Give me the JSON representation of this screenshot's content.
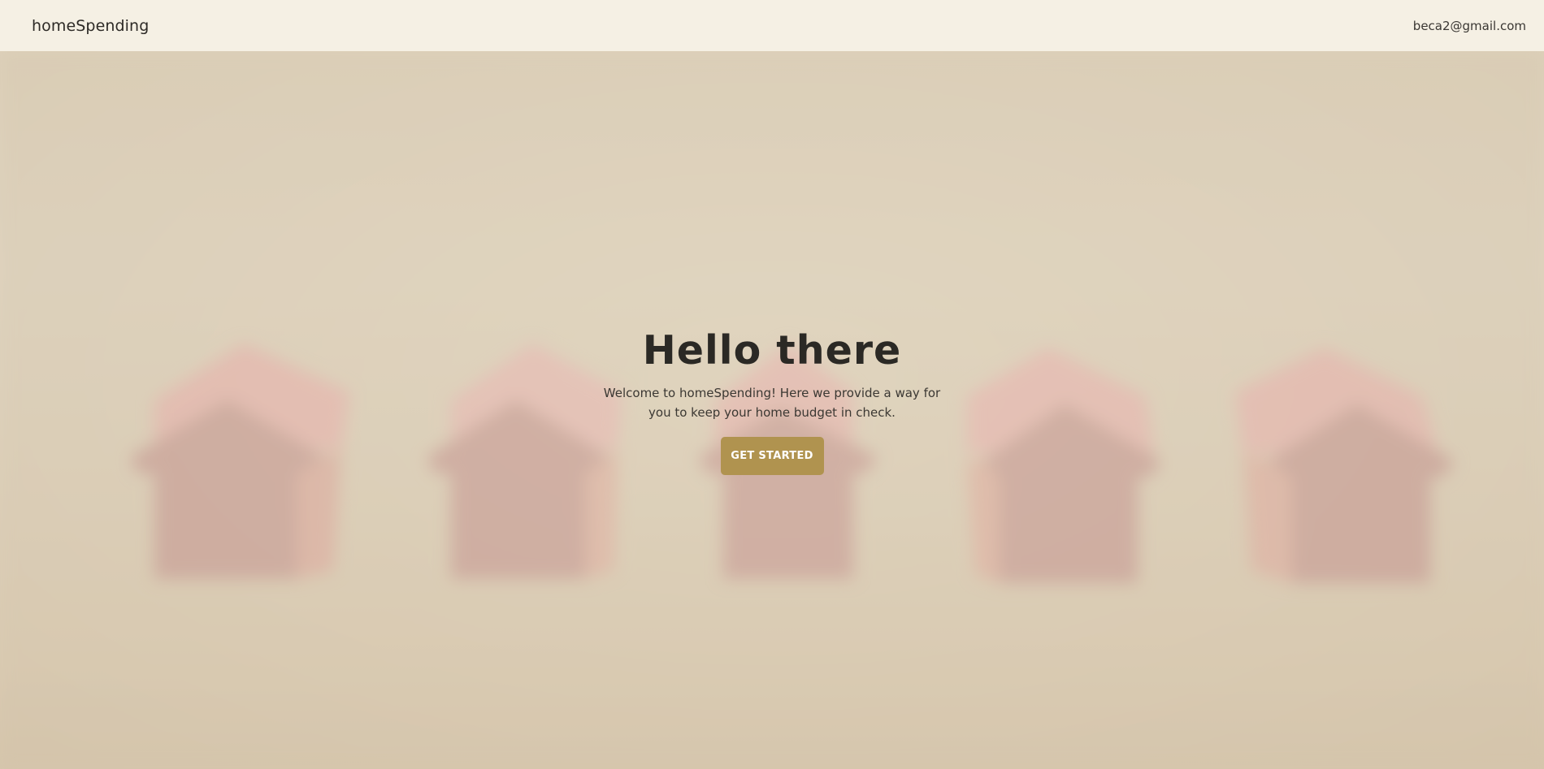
{
  "navbar": {
    "brand": "homeSpending",
    "user_email": "beca2@gmail.com"
  },
  "hero": {
    "title": "Hello there",
    "text": "Welcome to homeSpending! Here we provide a way for you to keep your home budget in check.",
    "cta_label": "GET STARTED",
    "background_description_icon": "blurred-red-toy-houses-image"
  },
  "colors": {
    "navbar_bg": "#f5f0e4",
    "hero_bg": "#ddd1bd",
    "cta_bg": "#b0934f",
    "text_dark": "#2b2925"
  }
}
